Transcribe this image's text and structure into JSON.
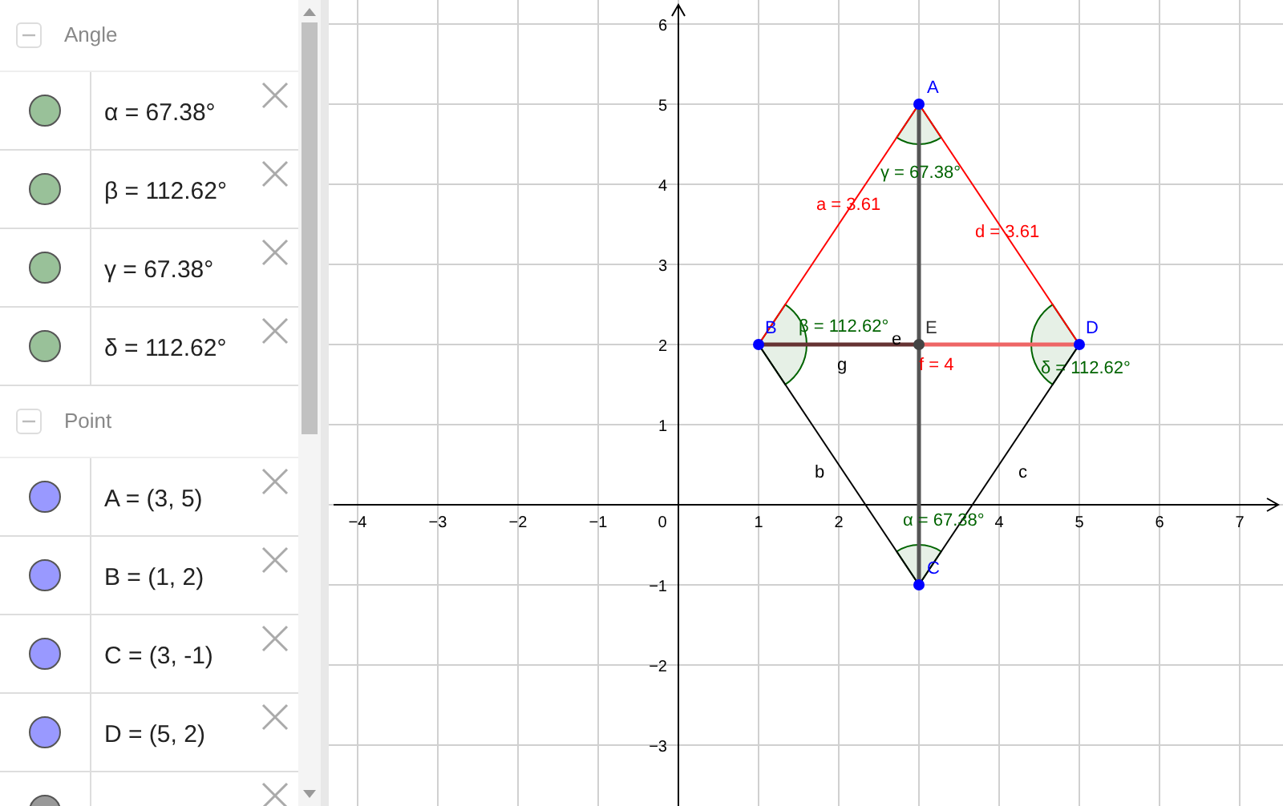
{
  "algebra": {
    "groups": [
      {
        "title": "Angle",
        "expanded": true,
        "items": [
          {
            "text": "α = 67.38°",
            "color": "#99c199"
          },
          {
            "text": "β = 112.62°",
            "color": "#99c199"
          },
          {
            "text": "γ = 67.38°",
            "color": "#99c199"
          },
          {
            "text": "δ = 112.62°",
            "color": "#99c199"
          }
        ]
      },
      {
        "title": "Point",
        "expanded": true,
        "items": [
          {
            "text": "A = (3, 5)",
            "color": "#9999ff"
          },
          {
            "text": "B = (1, 2)",
            "color": "#9999ff"
          },
          {
            "text": "C = (3, -1)",
            "color": "#9999ff"
          },
          {
            "text": "D = (5, 2)",
            "color": "#9999ff"
          },
          {
            "color": "#999999"
          }
        ]
      }
    ]
  },
  "graphics": {
    "points": [
      "A",
      "B",
      "E",
      "D",
      "C"
    ],
    "segment_labels": [
      "a = 3.61",
      "d = 3.61",
      "g",
      "e",
      "f = 4",
      "b",
      "c"
    ],
    "angle_labels": [
      "γ = 67.38°",
      "β = 112.62°",
      "δ = 112.62°",
      "α = 67.38°"
    ],
    "x_ticks": [
      "−4",
      "−3",
      "−2",
      "−1",
      "0",
      "1",
      "2",
      "4",
      "5",
      "6",
      "7"
    ],
    "y_ticks": [
      "6",
      "5",
      "4",
      "3",
      "2",
      "1",
      "−1",
      "−2",
      "−3"
    ]
  }
}
